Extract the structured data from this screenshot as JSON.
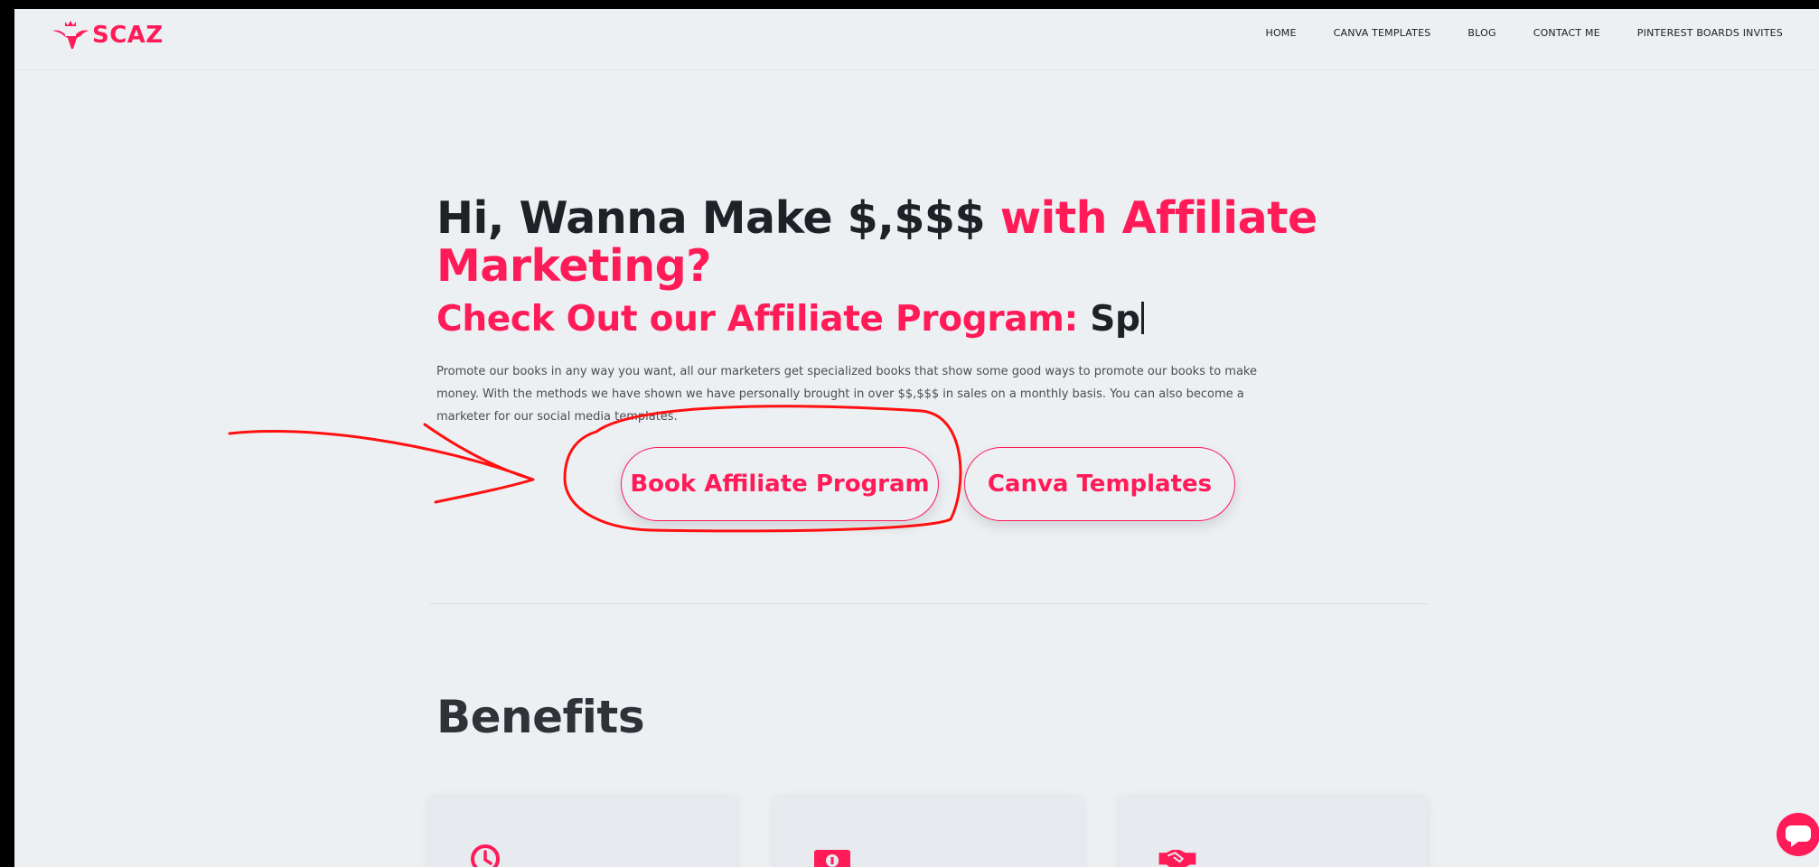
{
  "brand": {
    "name": "SCAZ",
    "color": "#ff1b58"
  },
  "nav": {
    "items": [
      "HOME",
      "CANVA TEMPLATES",
      "BLOG",
      "CONTACT ME",
      "PINTEREST BOARDS INVITES"
    ]
  },
  "hero": {
    "title_part1": "Hi, Wanna Make $,$$$ ",
    "title_part2": "with Affiliate Marketing?",
    "subtitle": "Check Out our Affiliate Program: ",
    "subtitle_typed": "Sp",
    "description": "Promote our books in any way you want, all our marketers get specialized books that show some good ways to promote our books to make money. With the methods we have shown we have personally brought in over $$,$$$ in sales on a monthly basis. You can also become a marketer for our social media templates."
  },
  "buttons": {
    "book_affiliate": "Book Affiliate Program",
    "canva_templates": "Canva Templates"
  },
  "benefits": {
    "title": "Benefits",
    "cards": [
      {
        "icon": "clock-icon"
      },
      {
        "icon": "money-bill-icon"
      },
      {
        "icon": "handshake-icon"
      }
    ]
  },
  "chat": {
    "icon": "chat-bubble-icon"
  },
  "annotation": {
    "color": "#ff1010",
    "shapes": [
      "arrow",
      "circle"
    ]
  }
}
